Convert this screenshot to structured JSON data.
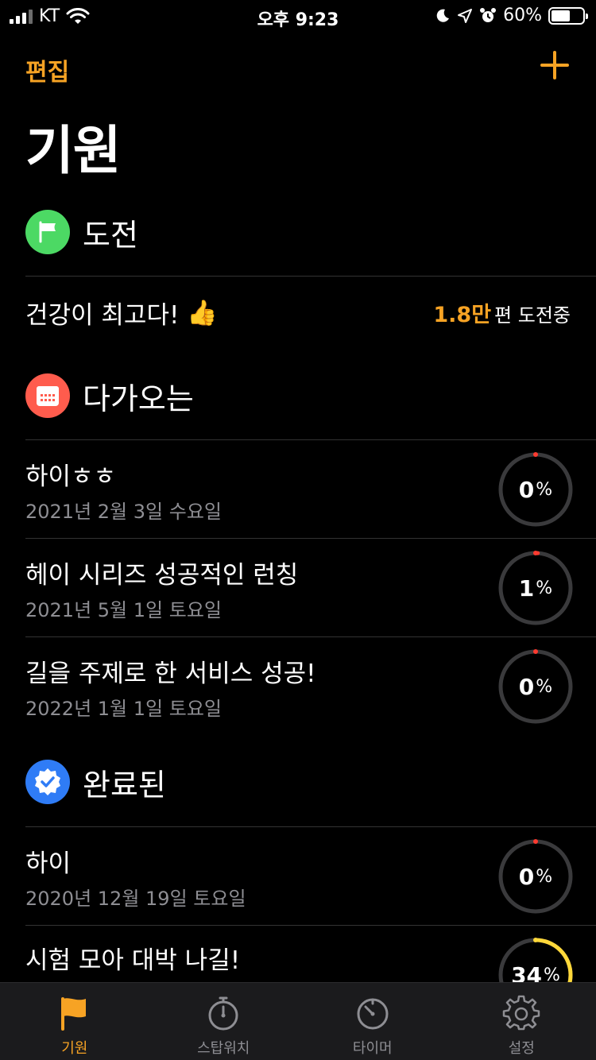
{
  "status_bar": {
    "carrier": "KT",
    "time": "오후 9:23",
    "battery": "60%",
    "battery_level": 0.6
  },
  "nav": {
    "edit_label": "편집",
    "page_title": "기원"
  },
  "colors": {
    "accent": "#f7a324",
    "challenge_icon": "#4cd964",
    "upcoming_icon": "#ff5c4d",
    "completed_icon": "#2f7cf6",
    "progress_yellow": "#ffd83a",
    "progress_red": "#ff3b30"
  },
  "sections": {
    "challenge": {
      "title": "도전",
      "icon": "flag-icon",
      "item": {
        "name": "건강이 최고다!",
        "emoji": "👍",
        "count": "1.8만",
        "count_suffix": "편 도전중"
      }
    },
    "upcoming": {
      "title": "다가오는",
      "icon": "calendar-icon",
      "items": [
        {
          "title": "하이ㅎㅎ",
          "date": "2021년 2월 3일 수요일",
          "percent": "0",
          "progress": 0
        },
        {
          "title": "헤이 시리즈 성공적인 런칭",
          "date": "2021년 5월 1일 토요일",
          "percent": "1",
          "progress": 1
        },
        {
          "title": "길을 주제로 한 서비스 성공!",
          "date": "2022년 1월 1일 토요일",
          "percent": "0",
          "progress": 0
        }
      ]
    },
    "completed": {
      "title": "완료된",
      "icon": "verified-badge-icon",
      "items": [
        {
          "title": "하이",
          "date": "2020년 12월 19일 토요일",
          "percent": "0",
          "progress": 0
        },
        {
          "title": "시험 모아 대박 나길!",
          "date": "",
          "percent": "34",
          "progress": 34
        }
      ]
    }
  },
  "tabs": [
    {
      "label": "기원",
      "icon": "flag-icon",
      "active": true
    },
    {
      "label": "스탑워치",
      "icon": "stopwatch-icon",
      "active": false
    },
    {
      "label": "타이머",
      "icon": "timer-icon",
      "active": false
    },
    {
      "label": "설정",
      "icon": "gear-icon",
      "active": false
    }
  ]
}
